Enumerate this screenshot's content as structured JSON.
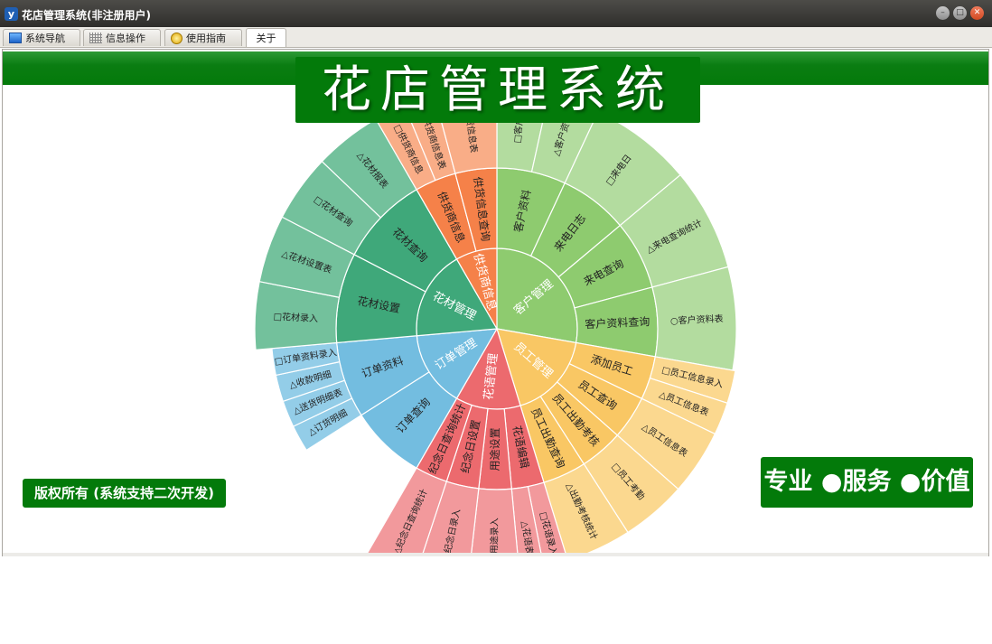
{
  "window": {
    "title": "花店管理系统(非注册用户)",
    "icon": "app-logo-icon"
  },
  "tabs": [
    {
      "label": "系统导航",
      "icon": "monitor-icon"
    },
    {
      "label": "信息操作",
      "icon": "grid-icon"
    },
    {
      "label": "使用指南",
      "icon": "guide-icon"
    },
    {
      "label": "关于",
      "icon": ""
    }
  ],
  "header": {
    "title": "花店管理系统",
    "bg_color": "#037a0a"
  },
  "copyright": "版权所有 (系统支持二次开发)",
  "slogan": "专业 ●服务 ●价值",
  "sunburst": {
    "segments": [
      {
        "label": "客户管理",
        "color": "#8ecb6f",
        "outer": "#b3dc9f",
        "children": [
          {
            "label": "客户资料",
            "items": [
              "□客户",
              "△客户资"
            ]
          },
          {
            "label": "来电日志",
            "items": [
              "□来电日"
            ]
          },
          {
            "label": "来电查询",
            "items": [
              "△来电查询统计"
            ]
          },
          {
            "label": "客户资料查询",
            "items": [
              "○客户资料表"
            ]
          }
        ]
      },
      {
        "label": "员工管理",
        "color": "#f9c764",
        "outer": "#fbd88f",
        "children": [
          {
            "label": "添加员工",
            "items": [
              "□员工信息录入",
              "△员工信息表"
            ]
          },
          {
            "label": "员工查询",
            "items": [
              "△员工信息表"
            ]
          },
          {
            "label": "员工出勤考核",
            "items": [
              "□员工考勤"
            ]
          },
          {
            "label": "员工出勤查询",
            "items": [
              "△出勤考核统计"
            ]
          }
        ]
      },
      {
        "label": "花语管理",
        "color": "#ec6a6e",
        "outer": "#f2999c",
        "children": [
          {
            "label": "花语编辑",
            "items": [
              "□花语录入",
              "△花语表"
            ]
          },
          {
            "label": "用途设置",
            "items": [
              "□用途录入"
            ]
          },
          {
            "label": "纪念日设置",
            "items": [
              "□纪念日录入"
            ]
          },
          {
            "label": "纪念日查询统计",
            "items": [
              "△纪念日查询统计"
            ]
          }
        ]
      },
      {
        "label": "订单管理",
        "color": "#73bde0",
        "outer": "#93cde8",
        "children": [
          {
            "label": "订单查询",
            "items": []
          },
          {
            "label": "订单资料",
            "items": [
              "△订货明细",
              "△送货明细表",
              "△收款明细",
              "□订单资料录入"
            ]
          }
        ]
      },
      {
        "label": "花材管理",
        "color": "#3fa87a",
        "outer": "#73c19c",
        "children": [
          {
            "label": "花材设置",
            "items": [
              "□花材录入",
              "△花材设置表"
            ]
          },
          {
            "label": "花材查询",
            "items": [
              "□花材查询",
              "△花材报表"
            ]
          }
        ]
      },
      {
        "label": "供货商信息",
        "color": "#f58149",
        "outer": "#f9ad87",
        "children": [
          {
            "label": "供货商信息",
            "items": [
              "□供货商信息",
              "□供货商信息表"
            ]
          },
          {
            "label": "供货信息查询",
            "items": [
              "供货信息表"
            ]
          }
        ]
      }
    ]
  }
}
